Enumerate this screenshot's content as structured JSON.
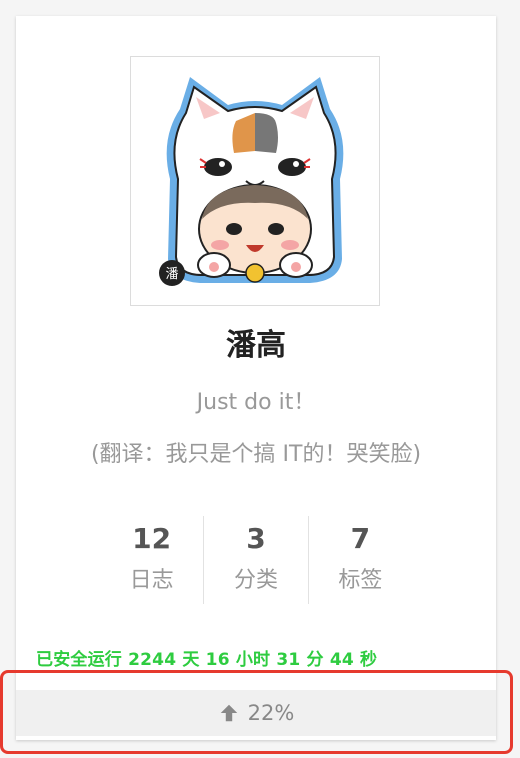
{
  "profile": {
    "name": "潘高",
    "motto": "Just do it！",
    "motto_translation": "(翻译：我只是个搞 IT的！哭笑脸)"
  },
  "stats": [
    {
      "count": "12",
      "label": "日志"
    },
    {
      "count": "3",
      "label": "分类"
    },
    {
      "count": "7",
      "label": "标签"
    }
  ],
  "runtime": "已安全运行 2244 天 16 小时 31 分 44 秒",
  "back_to_top": {
    "icon": "arrow-up-icon",
    "percent": "22%"
  },
  "colors": {
    "runtime_green": "#2ecc40",
    "highlight_red": "#e63a2e",
    "avatar_blue": "#6aaee6"
  }
}
